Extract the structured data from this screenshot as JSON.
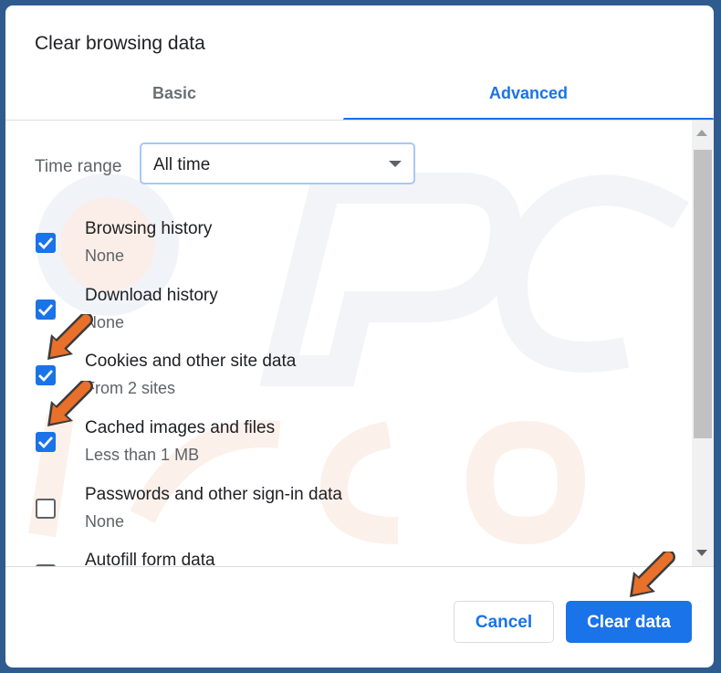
{
  "dialog": {
    "title": "Clear browsing data",
    "tabs": [
      {
        "label": "Basic",
        "active": false
      },
      {
        "label": "Advanced",
        "active": true
      }
    ]
  },
  "time_range": {
    "label": "Time range",
    "selected": "All time"
  },
  "items": [
    {
      "label": "Browsing history",
      "sub": "None",
      "checked": true
    },
    {
      "label": "Download history",
      "sub": "None",
      "checked": true
    },
    {
      "label": "Cookies and other site data",
      "sub": "From 2 sites",
      "checked": true
    },
    {
      "label": "Cached images and files",
      "sub": "Less than 1 MB",
      "checked": true
    },
    {
      "label": "Passwords and other sign-in data",
      "sub": "None",
      "checked": false
    },
    {
      "label": "Autofill form data",
      "sub": "",
      "checked": false
    }
  ],
  "buttons": {
    "cancel": "Cancel",
    "clear": "Clear data"
  },
  "watermark_text": "PC risk.com",
  "colors": {
    "accent": "#1a73e8",
    "annotation_arrow": "#e8702a",
    "frame": "#2f5b8f"
  }
}
